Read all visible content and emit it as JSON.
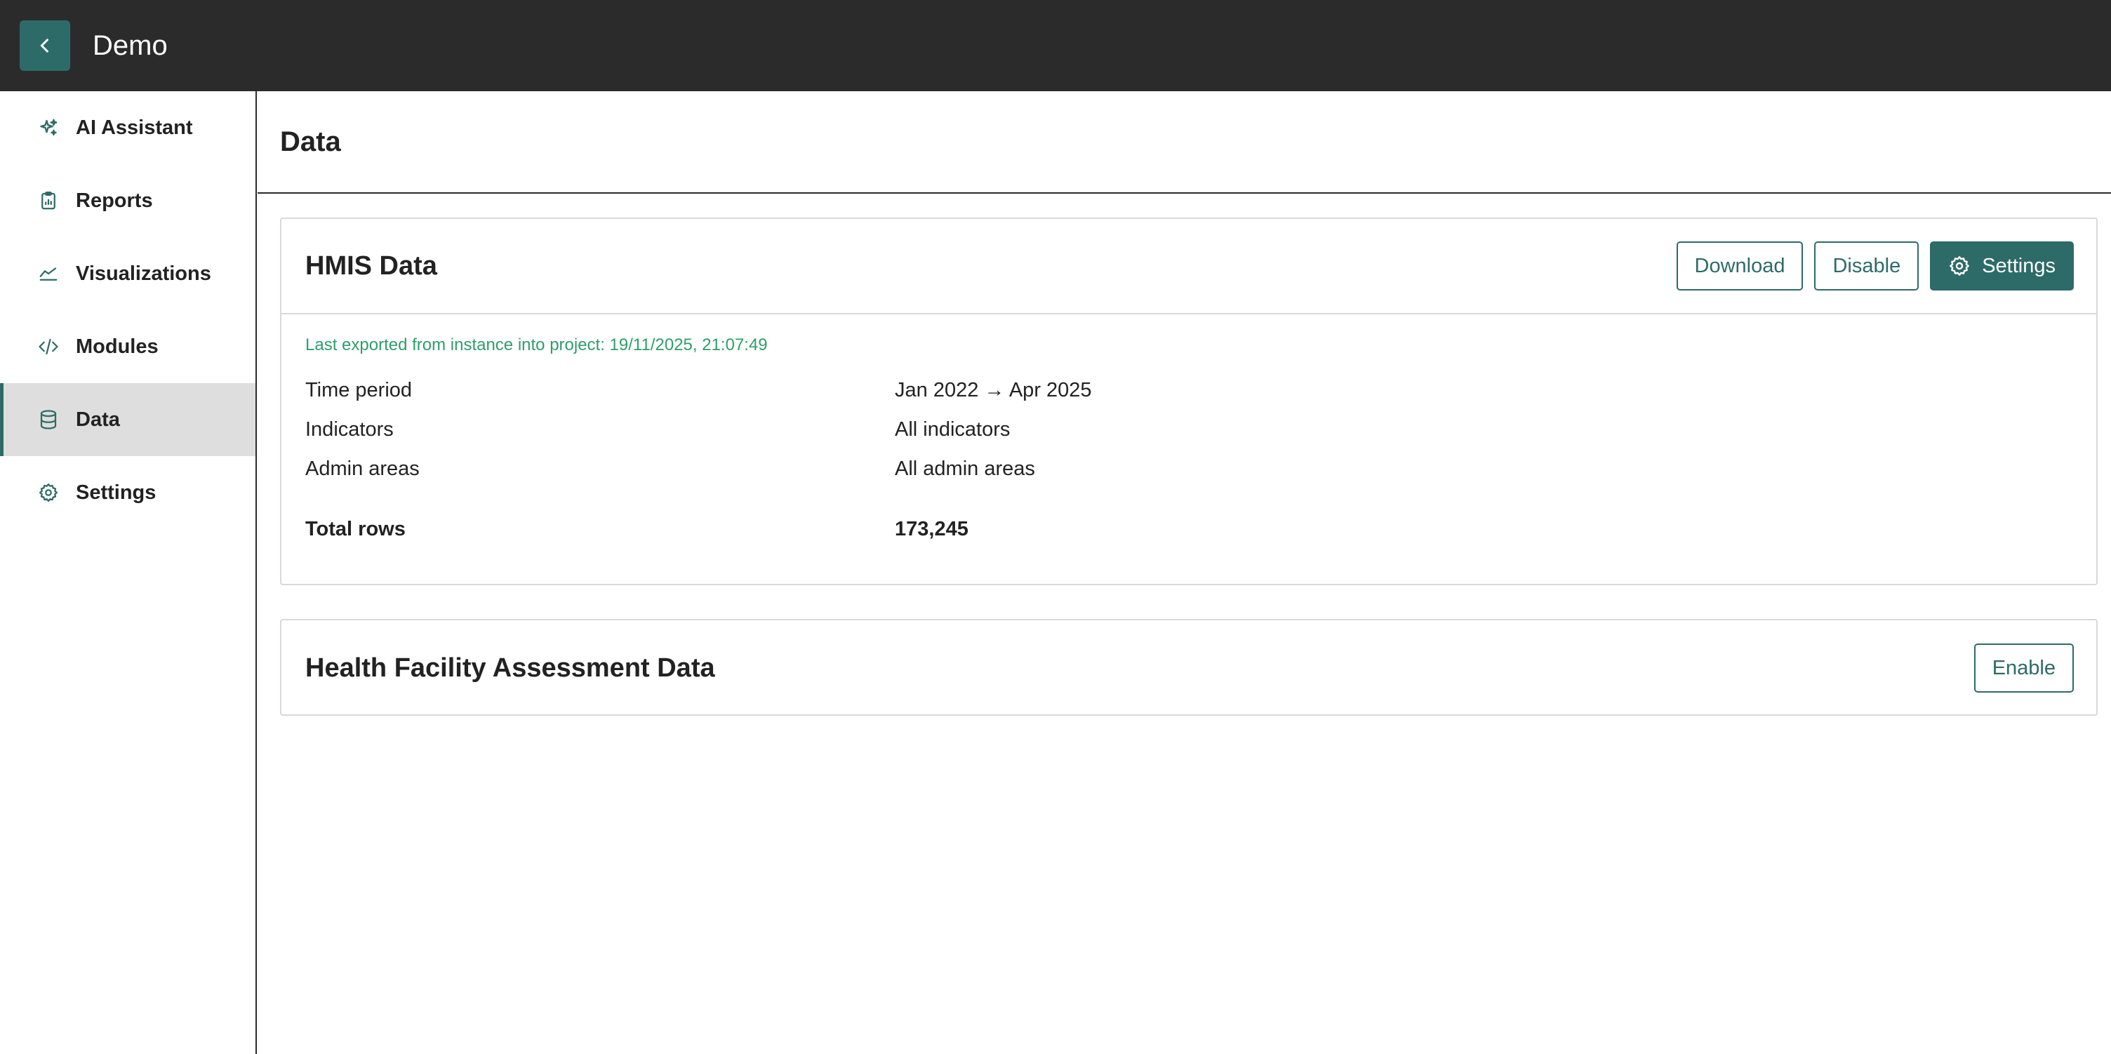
{
  "header": {
    "back_icon": "chevron-left-icon",
    "title": "Demo",
    "background": "#2b2b2b",
    "accent": "#2d6b68"
  },
  "sidebar": {
    "items": [
      {
        "label": "AI Assistant",
        "icon": "sparkles-icon",
        "active": false
      },
      {
        "label": "Reports",
        "icon": "clipboard-icon",
        "active": false
      },
      {
        "label": "Visualizations",
        "icon": "line-chart-icon",
        "active": false
      },
      {
        "label": "Modules",
        "icon": "code-icon",
        "active": false
      },
      {
        "label": "Data",
        "icon": "database-icon",
        "active": true
      },
      {
        "label": "Settings",
        "icon": "gear-icon",
        "active": false
      }
    ]
  },
  "main": {
    "page_title": "Data",
    "hmis": {
      "title": "HMIS Data",
      "download_label": "Download",
      "disable_label": "Disable",
      "settings_label": "Settings",
      "export_note": "Last exported from instance into project: 19/11/2025, 21:07:49",
      "export_note_color": "#2e9e6b",
      "rows": [
        {
          "key": "Time period",
          "value": "Jan 2022 → Apr 2025"
        },
        {
          "key": "Indicators",
          "value": "All indicators"
        },
        {
          "key": "Admin areas",
          "value": "All admin areas"
        }
      ],
      "total_label": "Total rows",
      "total_value": "173,245"
    },
    "hfa": {
      "title": "Health Facility Assessment Data",
      "enable_label": "Enable"
    }
  }
}
